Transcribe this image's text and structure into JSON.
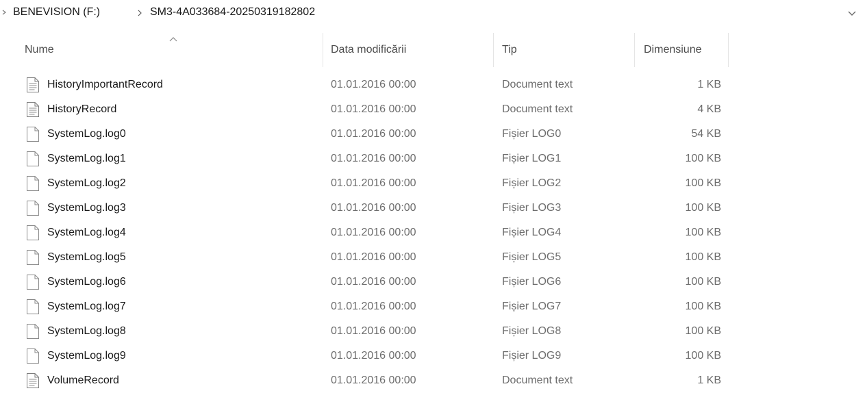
{
  "address_bar": {
    "breadcrumbs": [
      "BENEVISION (F:)",
      "SM3-4A033684-20250319182802"
    ]
  },
  "columns": {
    "name": "Nume",
    "date": "Data modificării",
    "type": "Tip",
    "size": "Dimensiune",
    "sort_column": "name"
  },
  "files": [
    {
      "name": "HistoryImportantRecord",
      "date": "01.01.2016 00:00",
      "type": "Document text",
      "size": "1 KB",
      "icon": "text-document-icon"
    },
    {
      "name": "HistoryRecord",
      "date": "01.01.2016 00:00",
      "type": "Document text",
      "size": "4 KB",
      "icon": "text-document-icon"
    },
    {
      "name": "SystemLog.log0",
      "date": "01.01.2016 00:00",
      "type": "Fișier LOG0",
      "size": "54 KB",
      "icon": "blank-file-icon"
    },
    {
      "name": "SystemLog.log1",
      "date": "01.01.2016 00:00",
      "type": "Fișier LOG1",
      "size": "100 KB",
      "icon": "blank-file-icon"
    },
    {
      "name": "SystemLog.log2",
      "date": "01.01.2016 00:00",
      "type": "Fișier LOG2",
      "size": "100 KB",
      "icon": "blank-file-icon"
    },
    {
      "name": "SystemLog.log3",
      "date": "01.01.2016 00:00",
      "type": "Fișier LOG3",
      "size": "100 KB",
      "icon": "blank-file-icon"
    },
    {
      "name": "SystemLog.log4",
      "date": "01.01.2016 00:00",
      "type": "Fișier LOG4",
      "size": "100 KB",
      "icon": "blank-file-icon"
    },
    {
      "name": "SystemLog.log5",
      "date": "01.01.2016 00:00",
      "type": "Fișier LOG5",
      "size": "100 KB",
      "icon": "blank-file-icon"
    },
    {
      "name": "SystemLog.log6",
      "date": "01.01.2016 00:00",
      "type": "Fișier LOG6",
      "size": "100 KB",
      "icon": "blank-file-icon"
    },
    {
      "name": "SystemLog.log7",
      "date": "01.01.2016 00:00",
      "type": "Fișier LOG7",
      "size": "100 KB",
      "icon": "blank-file-icon"
    },
    {
      "name": "SystemLog.log8",
      "date": "01.01.2016 00:00",
      "type": "Fișier LOG8",
      "size": "100 KB",
      "icon": "blank-file-icon"
    },
    {
      "name": "SystemLog.log9",
      "date": "01.01.2016 00:00",
      "type": "Fișier LOG9",
      "size": "100 KB",
      "icon": "blank-file-icon"
    },
    {
      "name": "VolumeRecord",
      "date": "01.01.2016 00:00",
      "type": "Document text",
      "size": "1 KB",
      "icon": "text-document-icon"
    }
  ]
}
